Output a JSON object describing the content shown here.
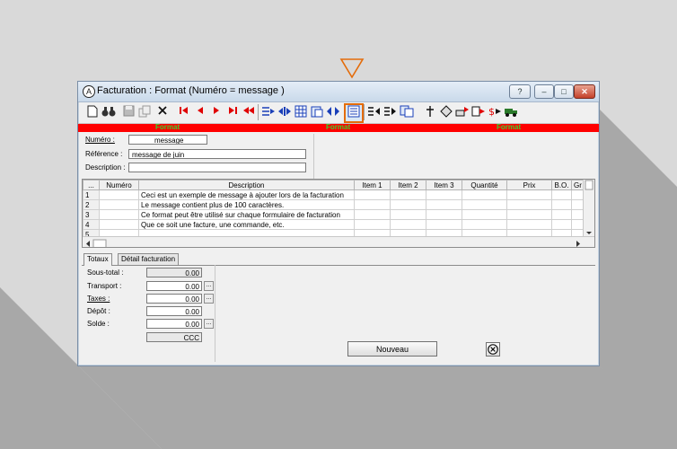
{
  "window": {
    "title": "Facturation : Format (Numéro = message )",
    "help_label": "?",
    "min_label": "–",
    "max_label": "□",
    "close_label": "✕"
  },
  "redbar": {
    "labels": [
      "Format",
      "Format",
      "Format"
    ]
  },
  "form": {
    "numero_label": "Numéro :",
    "numero_value": "message",
    "reference_label": "Référence :",
    "reference_value": "message de juin",
    "description_label": "Description :",
    "description_value": ""
  },
  "grid": {
    "columns": [
      "...",
      "Numéro",
      "Description",
      "Item 1",
      "Item 2",
      "Item 3",
      "Quantité",
      "Prix",
      "B.O.",
      "Gr"
    ],
    "rows": [
      {
        "n": "1",
        "description": "Ceci est un exemple de message à ajouter lors de la facturation"
      },
      {
        "n": "2",
        "description": "Le message contient plus de 100 caractères."
      },
      {
        "n": "3",
        "description": "Ce format peut être utilisé sur chaque formulaire de facturation"
      },
      {
        "n": "4",
        "description": "Que ce soit une facture, une commande, etc."
      },
      {
        "n": "5",
        "description": ""
      }
    ]
  },
  "tabs": [
    "Totaux",
    "Détail facturation"
  ],
  "totals": {
    "sous_total_label": "Sous-total :",
    "sous_total": "0.00",
    "transport_label": "Transport :",
    "transport": "0.00",
    "taxes_label": "Taxes :",
    "taxes": "0.00",
    "depot_label": "Dépôt :",
    "depot": "0.00",
    "solde_label": "Solde :",
    "solde": "0.00",
    "currency": "CCC",
    "dots": "..."
  },
  "buttons": {
    "nouveau": "Nouveau"
  },
  "colors": {
    "red_bar": "#ff0000",
    "green_text": "#39d12f",
    "selected_border": "#e46c0a",
    "pointer": "#e46c0a"
  }
}
